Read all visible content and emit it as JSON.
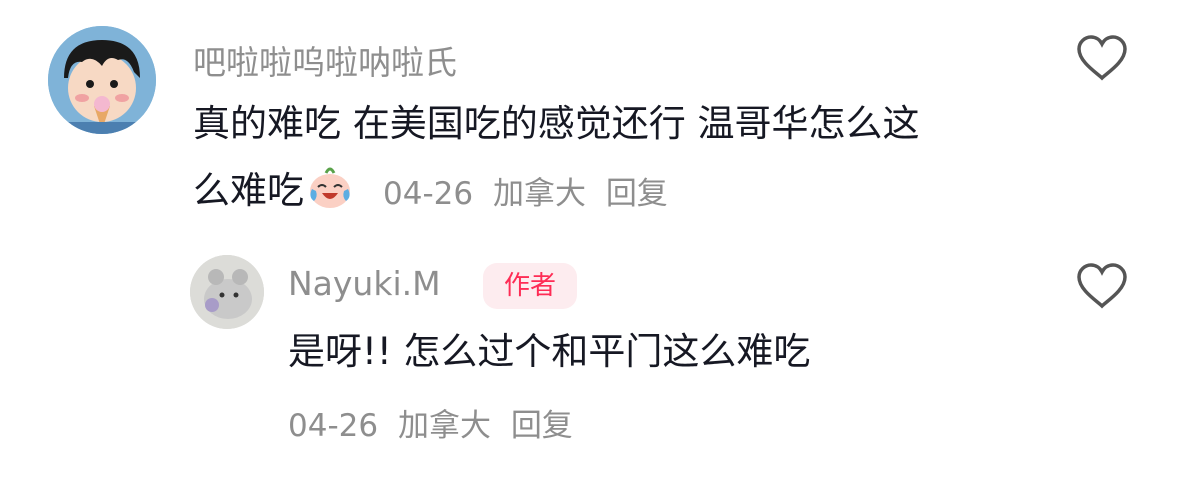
{
  "comment": {
    "username": "吧啦啦呜啦呐啦氏",
    "text_line1": "真的难吃 在美国吃的感觉还行 温哥华怎么这",
    "text_line2": "么难吃",
    "emoji": "laughing-crying-emoji",
    "date": "04-26",
    "location": "加拿大",
    "reply_label": "回复"
  },
  "reply": {
    "username": "Nayuki.M",
    "badge": "作者",
    "text": "是呀!!  怎么过个和平门这么难吃",
    "date": "04-26",
    "location": "加拿大",
    "reply_label": "回复"
  },
  "icons": {
    "like": "heart-outline-icon"
  },
  "colors": {
    "text": "#161823",
    "muted": "#8e8e8e",
    "badge_text": "#fe2c55",
    "badge_bg": "#fdecef"
  }
}
